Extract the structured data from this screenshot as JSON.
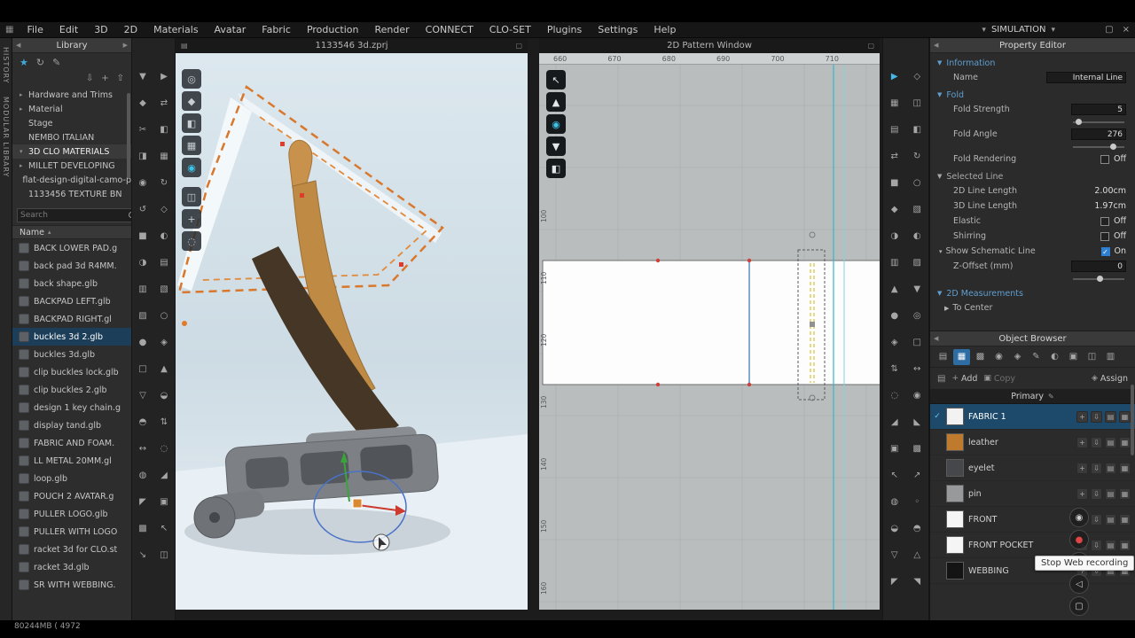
{
  "icons": {
    "app": "▦",
    "caret_down": "▾",
    "section_open": "▼",
    "section_closed": "▶",
    "collapse_left": "◀",
    "collapse_right": "▶",
    "maximize": "▢",
    "close": "×",
    "star": "★",
    "refresh": "↻",
    "brush": "✎",
    "import": "⇩",
    "add": "+",
    "export": "⇧",
    "grid_view": "▦",
    "sort_up": "▴",
    "titlebar_left": "▤",
    "titlebar_float": "▢",
    "check": "✓",
    "pencil": "✎",
    "folder": "▤",
    "copy": "▣",
    "assign": "◈"
  },
  "menubar": {
    "items": [
      "File",
      "Edit",
      "3D",
      "2D",
      "Materials",
      "Avatar",
      "Fabric",
      "Production",
      "Render",
      "CONNECT",
      "CLO-SET",
      "Plugins",
      "Settings",
      "Help"
    ],
    "simulation_label": "SIMULATION"
  },
  "side_tabs": [
    "HISTORY",
    "MODULAR LIBRARY"
  ],
  "library": {
    "title": "Library",
    "tree": [
      {
        "arrow": "▸",
        "label": "Hardware and Trims"
      },
      {
        "arrow": "▸",
        "label": "Material"
      },
      {
        "arrow": "",
        "label": "Stage"
      },
      {
        "arrow": "",
        "label": "NEMBO ITALIAN"
      },
      {
        "arrow": "▾",
        "label": "3D CLO MATERIALS",
        "selected": true
      },
      {
        "arrow": "▸",
        "label": "MILLET DEVELOPING"
      },
      {
        "arrow": "",
        "label": "flat-design-digital-camo-p"
      },
      {
        "arrow": "",
        "label": "1133456 TEXTURE BN"
      }
    ],
    "search_placeholder": "Search",
    "column_header": "Name",
    "files": [
      {
        "name": "BACK LOWER PAD.g"
      },
      {
        "name": "back pad 3d R4MM."
      },
      {
        "name": "back shape.glb"
      },
      {
        "name": "BACKPAD LEFT.glb"
      },
      {
        "name": "BACKPAD RIGHT.gl"
      },
      {
        "name": "buckles 3d 2.glb",
        "selected": true
      },
      {
        "name": "buckles 3d.glb"
      },
      {
        "name": "clip buckles lock.glb"
      },
      {
        "name": "clip buckles 2.glb"
      },
      {
        "name": "design 1 key chain.g"
      },
      {
        "name": "display tand.glb"
      },
      {
        "name": "FABRIC AND FOAM."
      },
      {
        "name": "LL METAL 20MM.gl"
      },
      {
        "name": "loop.glb"
      },
      {
        "name": "POUCH 2 AVATAR.g"
      },
      {
        "name": "PULLER LOGO.glb"
      },
      {
        "name": "PULLER WITH LOGO"
      },
      {
        "name": "racket 3d for CLO.st"
      },
      {
        "name": "racket 3d.glb"
      },
      {
        "name": "SR WITH WEBBING."
      }
    ]
  },
  "toolbar_3d": [
    "▼",
    "▶",
    "◆",
    "⇄",
    "✂",
    "◧",
    "◨",
    "▦",
    "◉",
    "↻",
    "↺",
    "◇",
    "■",
    "◐",
    "◑",
    "▤",
    "▥",
    "▧",
    "▨",
    "○",
    "●",
    "◈",
    "□",
    "▲",
    "▽",
    "◒",
    "◓",
    "⇅",
    "↔",
    "◌",
    "◍",
    "◢",
    "◤",
    "▣",
    "▩",
    "↖",
    "↘",
    "◫"
  ],
  "toolbar_right": [
    {
      "g": "▶",
      "active": true
    },
    {
      "g": "◇"
    },
    {
      "g": "▦"
    },
    {
      "g": "◫"
    },
    {
      "g": "▤"
    },
    {
      "g": "◧"
    },
    {
      "g": "⇄"
    },
    {
      "g": "↻"
    },
    {
      "g": "■"
    },
    {
      "g": "○"
    },
    {
      "g": "◆"
    },
    {
      "g": "▧"
    },
    {
      "g": "◑"
    },
    {
      "g": "◐"
    },
    {
      "g": "▥"
    },
    {
      "g": "▨"
    },
    {
      "g": "▲"
    },
    {
      "g": "▼"
    },
    {
      "g": "●"
    },
    {
      "g": "◎"
    },
    {
      "g": "◈"
    },
    {
      "g": "□"
    },
    {
      "g": "⇅"
    },
    {
      "g": "↔"
    },
    {
      "g": "◌"
    },
    {
      "g": "◉"
    },
    {
      "g": "◢"
    },
    {
      "g": "◣"
    },
    {
      "g": "▣"
    },
    {
      "g": "▩"
    },
    {
      "g": "↖"
    },
    {
      "g": "↗"
    },
    {
      "g": "◍"
    },
    {
      "g": "◦"
    },
    {
      "g": "◒"
    },
    {
      "g": "◓"
    },
    {
      "g": "▽"
    },
    {
      "g": "△"
    },
    {
      "g": "◤"
    },
    {
      "g": "◥"
    }
  ],
  "viewport3d": {
    "title": "1133546 3d.zprj",
    "toggles": [
      {
        "g": "◎"
      },
      {
        "g": "◆"
      },
      {
        "g": "◧"
      },
      {
        "g": "▦"
      },
      {
        "g": "◉",
        "active": true
      },
      {
        "g": "◫"
      },
      {
        "g": "+"
      },
      {
        "g": "◌"
      }
    ]
  },
  "pattern2d": {
    "title": "2D Pattern Window",
    "ruler_top": [
      "660",
      "670",
      "680",
      "690",
      "700",
      "710"
    ],
    "ruler_left": [
      "100",
      "110",
      "120",
      "130",
      "140",
      "150",
      "160"
    ],
    "tools": [
      {
        "g": "↖"
      },
      {
        "g": "▲"
      },
      {
        "g": "◉",
        "active": true
      },
      {
        "g": "▼"
      },
      {
        "g": "◧"
      }
    ]
  },
  "property_editor": {
    "title": "Property Editor",
    "info_section": "Information",
    "name_label": "Name",
    "name_value": "Internal Line",
    "fold_section": "Fold",
    "fold_strength_label": "Fold Strength",
    "fold_strength_value": "5",
    "fold_angle_label": "Fold Angle",
    "fold_angle_value": "276",
    "fold_rendering_label": "Fold Rendering",
    "fold_rendering_value": "Off",
    "selected_line_section": "Selected Line",
    "line2d_label": "2D Line Length",
    "line2d_value": "2.00cm",
    "line3d_label": "3D Line Length",
    "line3d_value": "1.97cm",
    "elastic_label": "Elastic",
    "elastic_value": "Off",
    "shirring_label": "Shirring",
    "shirring_value": "Off",
    "schematic_label": "Show Schematic Line",
    "schematic_value": "On",
    "zoffset_label": "Z-Offset (mm)",
    "zoffset_value": "0",
    "measurements_section": "2D Measurements",
    "tocenter_label": "To Center"
  },
  "object_browser": {
    "title": "Object Browser",
    "tabs": [
      {
        "g": "▤"
      },
      {
        "g": "▦",
        "active": true
      },
      {
        "g": "▩"
      },
      {
        "g": "◉"
      },
      {
        "g": "◈"
      },
      {
        "g": "✎"
      },
      {
        "g": "◐"
      },
      {
        "g": "▣"
      },
      {
        "g": "◫"
      },
      {
        "g": "▥"
      }
    ],
    "add_label": "Add",
    "copy_label": "Copy",
    "assign_label": "Assign",
    "primary_label": "Primary",
    "row_icons": [
      "+",
      "⇩",
      "▤",
      "▦"
    ],
    "fabrics": [
      {
        "name": "FABRIC 1",
        "swatch": "#f2f2f2",
        "selected": true,
        "check": "✓"
      },
      {
        "name": "leather",
        "swatch": "#c07a2e",
        "check": ""
      },
      {
        "name": "eyelet",
        "swatch": "#46474b",
        "check": ""
      },
      {
        "name": "pin",
        "swatch": "#97999b",
        "check": ""
      },
      {
        "name": "FRONT",
        "swatch": "#f5f5f5",
        "check": ""
      },
      {
        "name": "FRONT POCKET",
        "swatch": "#f5f5f5",
        "check": ""
      },
      {
        "name": "WEBBING",
        "swatch": "#141414",
        "check": ""
      }
    ]
  },
  "recording_dock": [
    {
      "n": "camera-icon",
      "g": "◉",
      "c": "#cccccc"
    },
    {
      "n": "record-icon",
      "g": "●",
      "c": "#e04545"
    },
    {
      "n": "person-icon",
      "g": "◔",
      "c": "#cccccc"
    },
    {
      "n": "speaker-icon",
      "g": "◁",
      "c": "#cccccc"
    },
    {
      "n": "screen-icon",
      "g": "▢",
      "c": "#cccccc"
    }
  ],
  "tooltip": "Stop Web recording",
  "status_text": "80244MB (  4972"
}
